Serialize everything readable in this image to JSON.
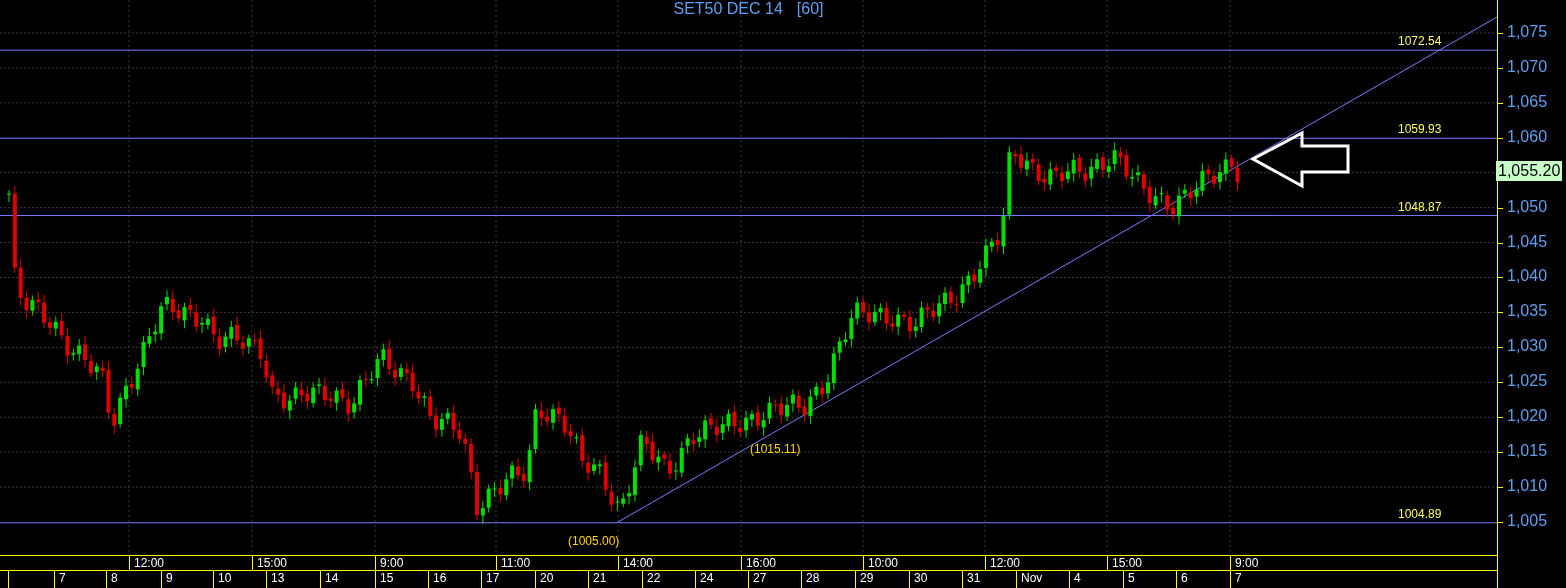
{
  "chart": {
    "title": "SET50 DEC 14",
    "interval": "[60]",
    "y_ticks": [
      "1,075",
      "1,070",
      "1,065",
      "1,060",
      "1,050",
      "1,045",
      "1,040",
      "1,035",
      "1,030",
      "1,025",
      "1,020",
      "1,015",
      "1,010",
      "1,005"
    ],
    "levels": [
      {
        "label": "1072.54"
      },
      {
        "label": "1059.93"
      },
      {
        "label": "1048.87"
      },
      {
        "label": "1004.89"
      }
    ],
    "annotations": [
      {
        "label": "(1005.00)"
      },
      {
        "label": "(1015.11)"
      }
    ],
    "last_price": "1,055.20"
  },
  "time_axis": {
    "hours": [
      "12:00",
      "15:00",
      "9:00",
      "11:00",
      "14:00",
      "16:00",
      "10:00",
      "12:00",
      "15:00",
      "9:00"
    ],
    "days": [
      "7",
      "8",
      "9",
      "10",
      "13",
      "14",
      "15",
      "16",
      "17",
      "20",
      "21",
      "22",
      "24",
      "27",
      "28",
      "29",
      "30",
      "31",
      "Nov",
      "4",
      "5",
      "6",
      "7"
    ]
  }
}
